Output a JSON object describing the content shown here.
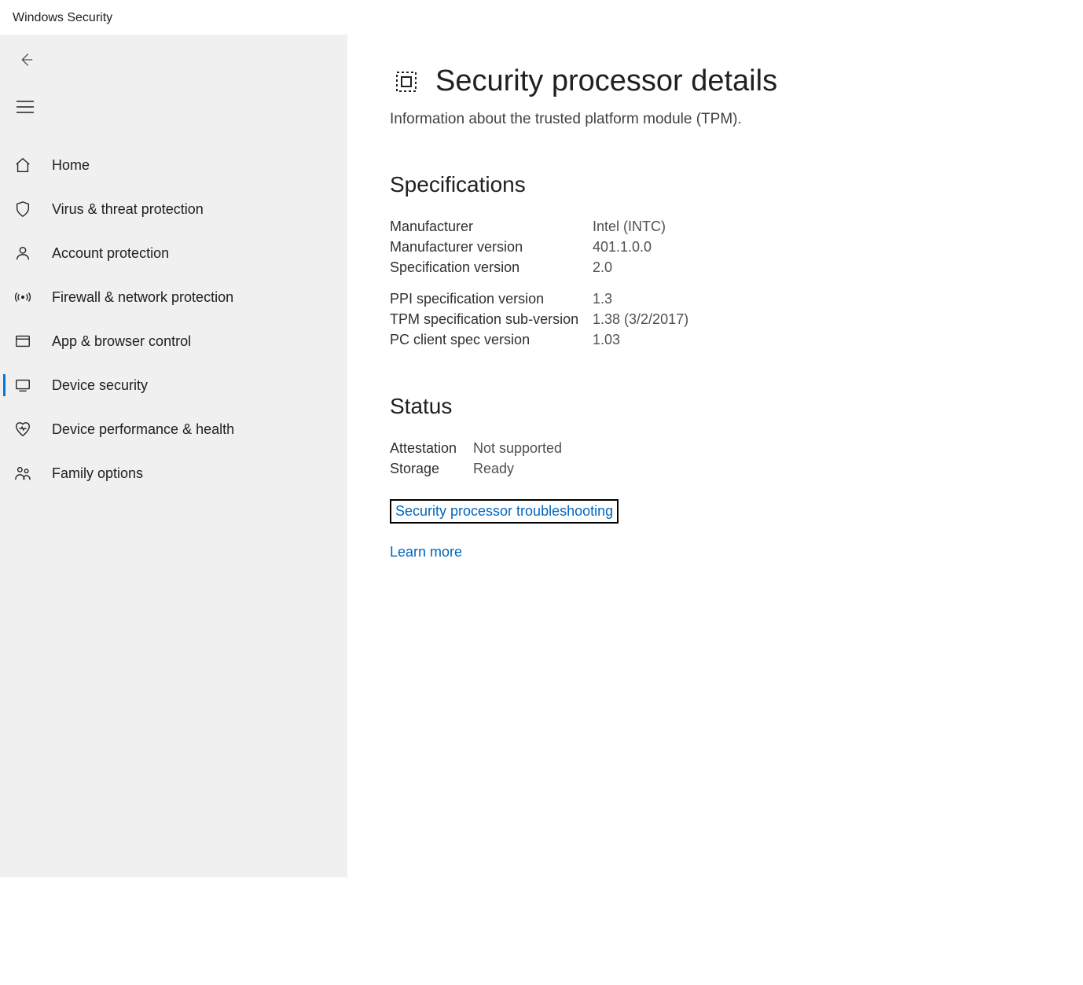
{
  "app_title": "Windows Security",
  "sidebar": {
    "items": [
      {
        "label": "Home"
      },
      {
        "label": "Virus & threat protection"
      },
      {
        "label": "Account protection"
      },
      {
        "label": "Firewall & network protection"
      },
      {
        "label": "App & browser control"
      },
      {
        "label": "Device security"
      },
      {
        "label": "Device performance & health"
      },
      {
        "label": "Family options"
      }
    ]
  },
  "main": {
    "title": "Security processor details",
    "subtitle": "Information about the trusted platform module (TPM).",
    "specifications_heading": "Specifications",
    "specs_group1": [
      {
        "label": "Manufacturer",
        "value": "Intel (INTC)"
      },
      {
        "label": "Manufacturer version",
        "value": "401.1.0.0"
      },
      {
        "label": "Specification version",
        "value": "2.0"
      }
    ],
    "specs_group2": [
      {
        "label": "PPI specification version",
        "value": "1.3"
      },
      {
        "label": "TPM specification sub-version",
        "value": "1.38 (3/2/2017)"
      },
      {
        "label": "PC client spec version",
        "value": "1.03"
      }
    ],
    "status_heading": "Status",
    "status_rows": [
      {
        "label": "Attestation",
        "value": "Not supported"
      },
      {
        "label": "Storage",
        "value": "Ready"
      }
    ],
    "troubleshooting_link": "Security processor troubleshooting",
    "learn_more_link": "Learn more"
  }
}
